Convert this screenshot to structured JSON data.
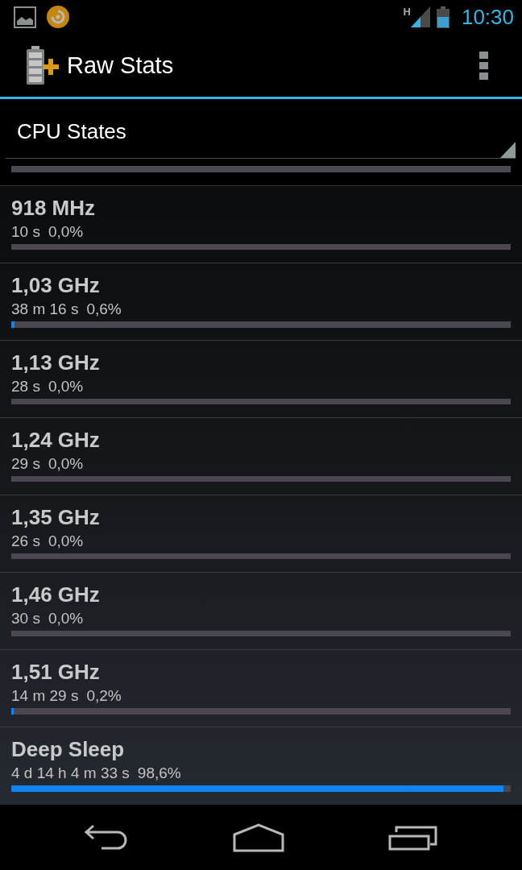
{
  "status_bar": {
    "network_type": "H",
    "time": "10:30"
  },
  "action_bar": {
    "title": "Raw Stats"
  },
  "spinner": {
    "value": "CPU States"
  },
  "states": [
    {
      "name": "918 MHz",
      "duration": "10 s",
      "percent": "0,0%"
    },
    {
      "name": "1,03 GHz",
      "duration": "38 m 16 s",
      "percent": "0,6%",
      "level": 0.006
    },
    {
      "name": "1,13 GHz",
      "duration": "28 s",
      "percent": "0,0%"
    },
    {
      "name": "1,24 GHz",
      "duration": "29 s",
      "percent": "0,0%"
    },
    {
      "name": "1,35 GHz",
      "duration": "26 s",
      "percent": "0,0%"
    },
    {
      "name": "1,46 GHz",
      "duration": "30 s",
      "percent": "0,0%"
    },
    {
      "name": "1,51 GHz",
      "duration": "14 m 29 s",
      "percent": "0,2%",
      "level": 0.002
    },
    {
      "name": "Deep Sleep",
      "duration": "4 d 14 h 4 m 33 s",
      "percent": "98,6%",
      "level": 0.986
    }
  ]
}
